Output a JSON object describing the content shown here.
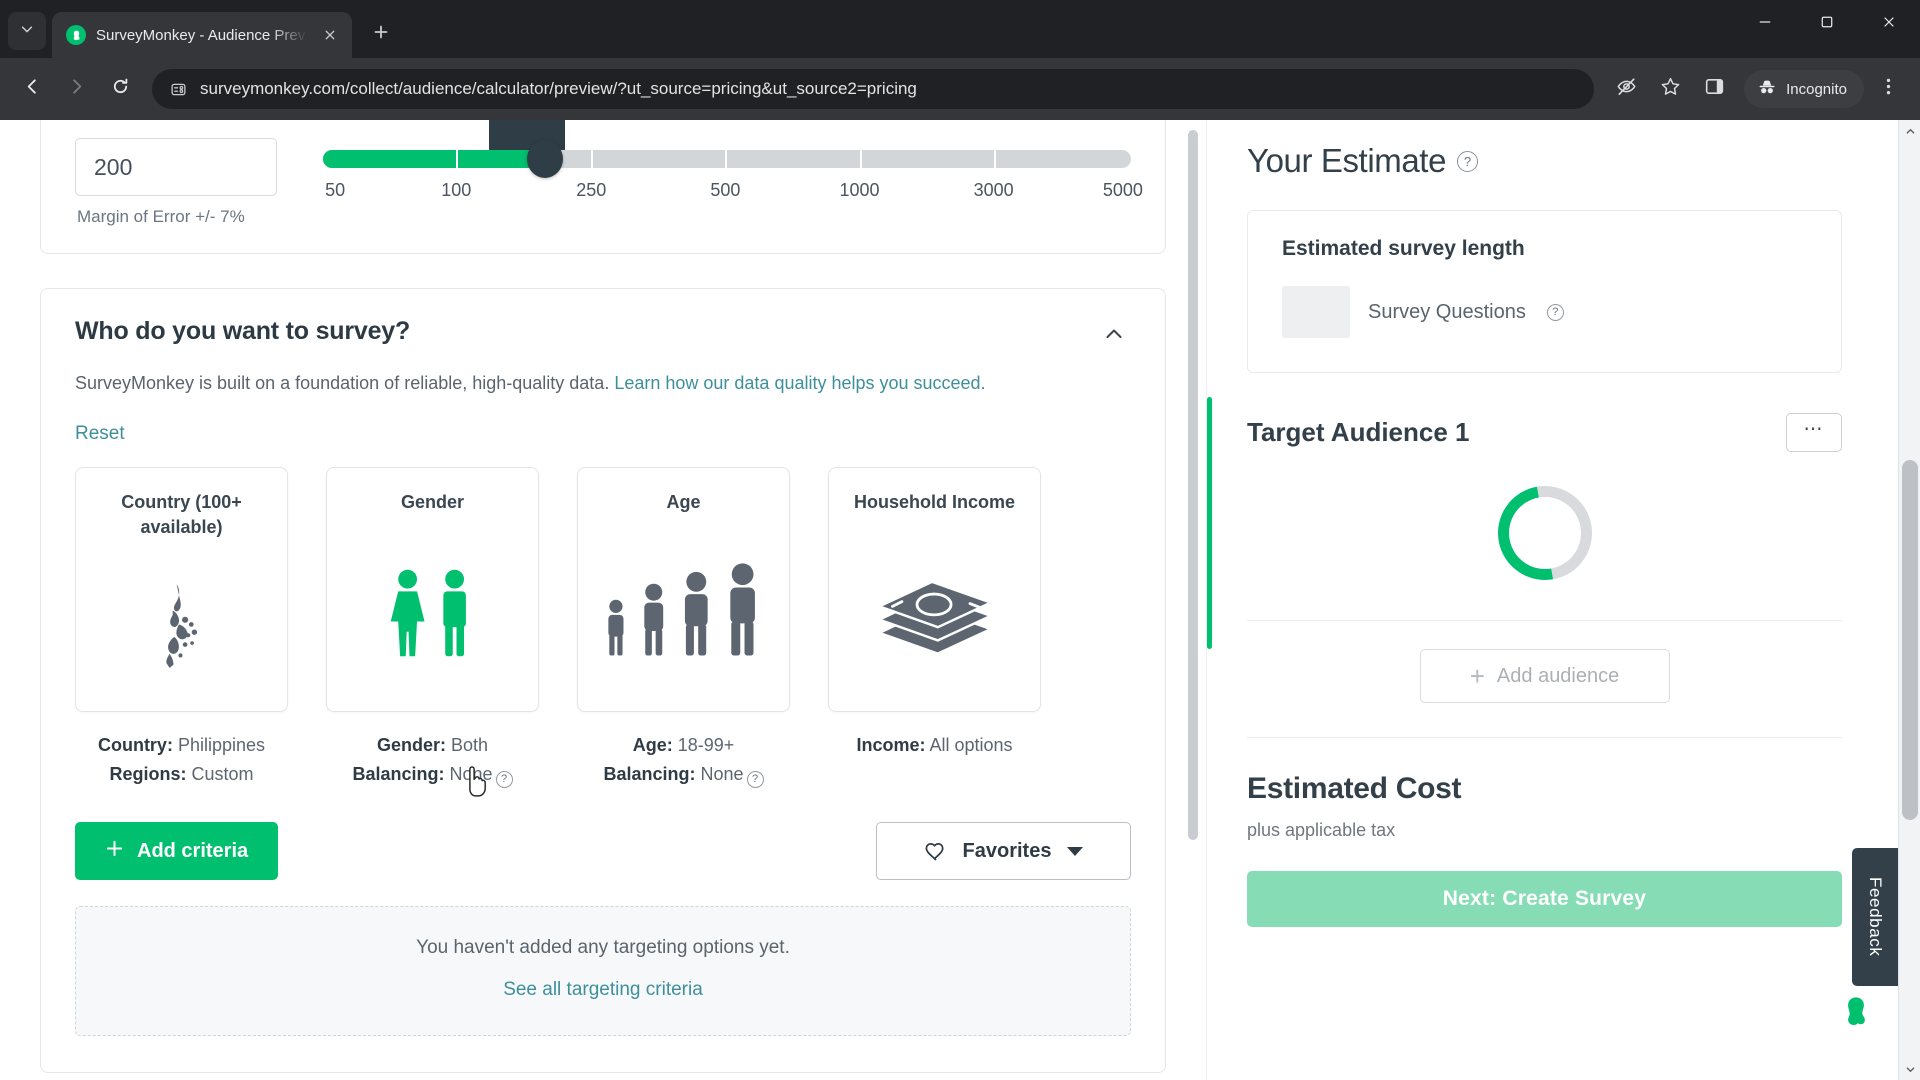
{
  "browser": {
    "tab": {
      "title": "SurveyMonkey - Audience Prev",
      "favicon_icon": "surveymonkey-logo-icon"
    },
    "tab_search_icon": "chevron-down-icon",
    "new_tab_icon": "plus-icon",
    "close_tab_icon": "close-icon",
    "window_controls": {
      "minimize": "minimize-icon",
      "maximize": "maximize-icon",
      "close": "close-icon"
    },
    "nav": {
      "back_icon": "arrow-left-icon",
      "forward_icon": "arrow-right-icon",
      "reload_icon": "reload-icon"
    },
    "url": "surveymonkey.com/collect/audience/calculator/preview/?ut_source=pricing&ut_source2=pricing",
    "site_info_icon": "page-info-icon",
    "toolbar_icons": {
      "tracking_protection": "eye-slash-icon",
      "bookmark": "star-icon",
      "side_panel": "side-panel-icon",
      "menu": "three-dot-menu-icon"
    },
    "incognito": {
      "label": "Incognito",
      "icon": "incognito-hat-icon"
    }
  },
  "slider_card": {
    "value": "200",
    "margin_of_error": "Margin of Error +/- 7%",
    "ticks": [
      "50",
      "100",
      "250",
      "500",
      "1000",
      "3000",
      "5000"
    ],
    "fill_color": "#00bf6f",
    "knob_color": "#2f3d46"
  },
  "survey_section": {
    "title": "Who do you want to survey?",
    "subtitle_prefix": "SurveyMonkey is built on a foundation of reliable, high-quality data. ",
    "subtitle_link": "Learn how our data quality helps you succeed.",
    "collapse_icon": "chevron-up-icon",
    "reset_label": "Reset",
    "criteria_cards": [
      {
        "title": "Country (100+ available)",
        "art": "philippines-map-icon"
      },
      {
        "title": "Gender",
        "art": "gender-figures-icon"
      },
      {
        "title": "Age",
        "art": "age-figures-icon"
      },
      {
        "title": "Household Income",
        "art": "money-stack-icon"
      }
    ],
    "captions": [
      {
        "line1_label": "Country:",
        "line1_value": "Philippines",
        "line2_label": "Regions:",
        "line2_value": "Custom",
        "has_help": false
      },
      {
        "line1_label": "Gender:",
        "line1_value": "Both",
        "line2_label": "Balancing:",
        "line2_value": "None",
        "has_help": true
      },
      {
        "line1_label": "Age:",
        "line1_value": "18-99+",
        "line2_label": "Balancing:",
        "line2_value": "None",
        "has_help": true
      },
      {
        "line1_label": "Income:",
        "line1_value": "All options",
        "line2_label": "",
        "line2_value": "",
        "has_help": false
      }
    ],
    "add_criteria_label": "Add criteria",
    "add_criteria_icon": "plus-icon",
    "favorites_label": "Favorites",
    "favorites_icon": "heart-icon",
    "favorites_caret_icon": "caret-down-icon",
    "empty_state": {
      "message": "You haven't added any targeting options yet.",
      "link": "See all targeting criteria"
    }
  },
  "estimate_panel": {
    "title": "Your Estimate",
    "title_help_icon": "question-circle-icon",
    "length_box": {
      "title": "Estimated survey length",
      "label": "Survey Questions",
      "help_icon": "question-circle-icon"
    },
    "target_audience": {
      "title": "Target Audience 1",
      "menu_label": "⋯",
      "spinner": "loading-spinner-icon"
    },
    "add_audience_label": "Add audience",
    "add_audience_icon": "plus-icon",
    "cost": {
      "title": "Estimated Cost",
      "subtitle": "plus applicable tax",
      "cta_label": "Next: Create Survey",
      "cta_color": "#86dcb4"
    }
  },
  "feedback_tab": {
    "label": "Feedback",
    "fab_icon": "surveymonkey-logo-icon"
  }
}
